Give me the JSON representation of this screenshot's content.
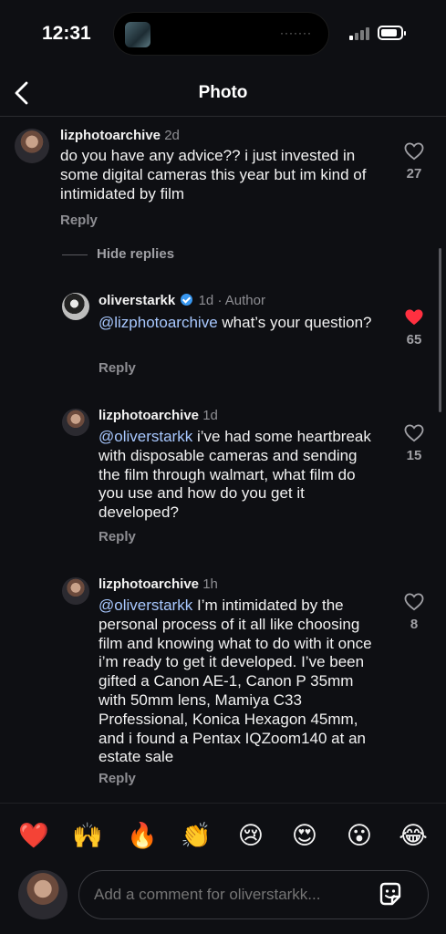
{
  "status_bar": {
    "time": "12:31",
    "island_indicator": "·······"
  },
  "nav": {
    "title": "Photo",
    "back_icon": "chevron-left-icon"
  },
  "comments": [
    {
      "username": "lizphotoarchive",
      "time": "2d",
      "text": "do you have any advice?? i just invested in some digital cameras this year but im kind of intimidated by film",
      "reply_label": "Reply",
      "likes": "27",
      "liked": false
    }
  ],
  "hide_replies_label": "Hide replies",
  "replies": [
    {
      "username": "oliverstarkk",
      "verified": true,
      "time": "1d",
      "author_badge": "· Author",
      "mention": "@lizphotoarchive",
      "text": "what’s your question?",
      "reply_label": "Reply",
      "likes": "65",
      "liked": true
    },
    {
      "username": "lizphotoarchive",
      "time": "1d",
      "mention": "@oliverstarkk",
      "text": "i’ve had some heartbreak with disposable cameras and sending the film through walmart, what film do you use and how do you get it developed?",
      "reply_label": "Reply",
      "likes": "15",
      "liked": false
    },
    {
      "username": "lizphotoarchive",
      "time": "1h",
      "mention": "@oliverstarkk",
      "text": "I’m intimidated by the personal process of it all like choosing film and knowing what to do with it once i’m ready to get it developed. I’ve been gifted a Canon AE-1, Canon P 35mm with 50mm lens, Mamiya C33 Professional, Konica Hexagon 45mm, and i found a Pentax IQZoom140 at an estate sale",
      "reply_label": "Reply",
      "likes": "8",
      "liked": false
    }
  ],
  "emoji_bar": [
    "❤️",
    "🙌",
    "🔥",
    "👏",
    "😢",
    "😍",
    "😮",
    "😂"
  ],
  "compose": {
    "placeholder": "Add a comment for oliverstarkk...",
    "sticker_icon": "sticker-icon"
  },
  "colors": {
    "background": "#0e0f13",
    "mention": "#a8c8ff",
    "like_active": "#ff3040",
    "verified": "#3897f0"
  }
}
